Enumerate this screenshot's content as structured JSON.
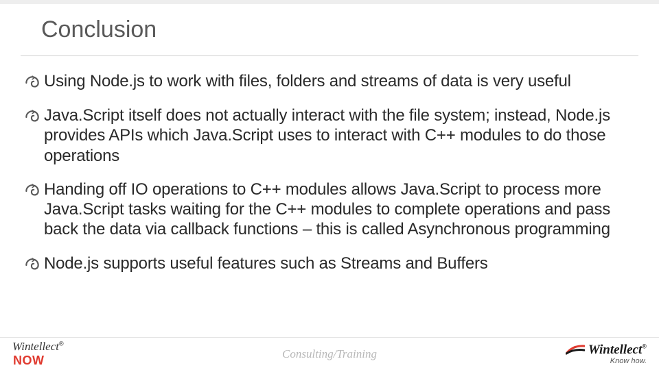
{
  "title": "Conclusion",
  "bullets": [
    "Using Node.js to work with files, folders and streams of data is very useful",
    "Java.Script itself does not actually interact with the file system; instead, Node.js provides APIs which Java.Script uses to interact with C++ modules to do those operations",
    "Handing off IO operations to C++ modules allows Java.Script to process more Java.Script tasks waiting for the C++ modules to complete operations and pass back the data via callback functions – this is called Asynchronous programming",
    "Node.js supports useful features such as Streams and Buffers"
  ],
  "footer": {
    "center": "Consulting/Training",
    "left_brand_1": "Wintellect",
    "left_brand_2": "NOW",
    "right_brand": "Wintellect",
    "right_tag": "Know how."
  },
  "colors": {
    "title_rule": "#cfcfcf",
    "bullet_icon": "#595959",
    "accent_red": "#e03a2f"
  }
}
